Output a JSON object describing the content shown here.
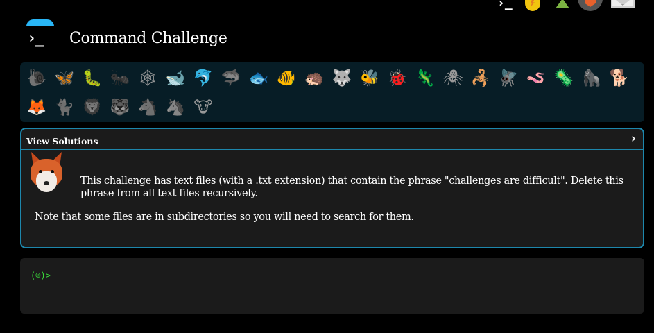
{
  "top_icons": [
    {
      "name": "terminal-icon",
      "glyph": "›_"
    },
    {
      "name": "lightbulb-icon"
    },
    {
      "name": "tree-icon"
    },
    {
      "name": "shield-badge-icon"
    },
    {
      "name": "mail-icon"
    }
  ],
  "header": {
    "logo_glyph": "›_",
    "title": "Command Challenge"
  },
  "animals": {
    "row1": [
      {
        "name": "snail-icon",
        "glyph": "🐌",
        "status": "locked"
      },
      {
        "name": "butterfly-icon",
        "glyph": "🦋",
        "status": "unlocked"
      },
      {
        "name": "caterpillar-icon",
        "glyph": "🐛",
        "status": "unlocked"
      },
      {
        "name": "ant-icon",
        "glyph": "🐜",
        "status": "locked"
      },
      {
        "name": "spiderweb-icon",
        "glyph": "🕸",
        "status": "locked"
      },
      {
        "name": "whale-icon",
        "glyph": "🐋",
        "status": "unlocked"
      },
      {
        "name": "dolphin-icon",
        "glyph": "🐬",
        "status": "unlocked"
      },
      {
        "name": "shark-icon",
        "glyph": "🦈",
        "status": "locked"
      },
      {
        "name": "fish-icon",
        "glyph": "🐟",
        "status": "unlocked"
      },
      {
        "name": "tropical-fish-icon",
        "glyph": "🐠",
        "status": "unlocked"
      },
      {
        "name": "hedgehog-icon",
        "glyph": "🦔",
        "status": "unlocked"
      },
      {
        "name": "wolf-icon",
        "glyph": "🐺",
        "status": "unlocked"
      },
      {
        "name": "bee-icon",
        "glyph": "🐝",
        "status": "unlocked"
      },
      {
        "name": "ladybug-icon",
        "glyph": "🐞",
        "status": "unlocked"
      },
      {
        "name": "lizard-icon",
        "glyph": "🦎",
        "status": "unlocked"
      },
      {
        "name": "spider-icon",
        "glyph": "🕷",
        "status": "locked"
      },
      {
        "name": "scorpion-icon",
        "glyph": "🦂",
        "status": "unlocked"
      },
      {
        "name": "fly-icon",
        "glyph": "🪰",
        "status": "unlocked"
      },
      {
        "name": "worm-icon",
        "glyph": "🪱",
        "status": "unlocked"
      },
      {
        "name": "microbe-icon",
        "glyph": "🦠",
        "status": "unlocked"
      },
      {
        "name": "gorilla-icon",
        "glyph": "🦍",
        "status": "unlocked"
      },
      {
        "name": "dog-icon",
        "glyph": "🐕",
        "status": "unlocked"
      }
    ],
    "row2": [
      {
        "name": "fox-icon",
        "glyph": "🦊",
        "status": "unlocked"
      },
      {
        "name": "cougar-icon",
        "glyph": "🐈",
        "status": "locked"
      },
      {
        "name": "lion-icon",
        "glyph": "🦁",
        "status": "locked"
      },
      {
        "name": "tiger-icon",
        "glyph": "🐯",
        "status": "locked"
      },
      {
        "name": "horse-icon",
        "glyph": "🐴",
        "status": "locked"
      },
      {
        "name": "unicorn-icon",
        "glyph": "🦄",
        "status": "locked"
      },
      {
        "name": "cow-icon",
        "glyph": "🐮",
        "status": "locked"
      }
    ]
  },
  "panel": {
    "title": "View Solutions",
    "chevron": "›",
    "description": "This challenge has text files (with a .txt extension) that contain the phrase \"challenges are difficult\". Delete this phrase from all text files recursively.",
    "note": "Note that some files are in subdirectories so you will need to search for them."
  },
  "terminal": {
    "prompt": "(☺)>",
    "input_value": ""
  }
}
